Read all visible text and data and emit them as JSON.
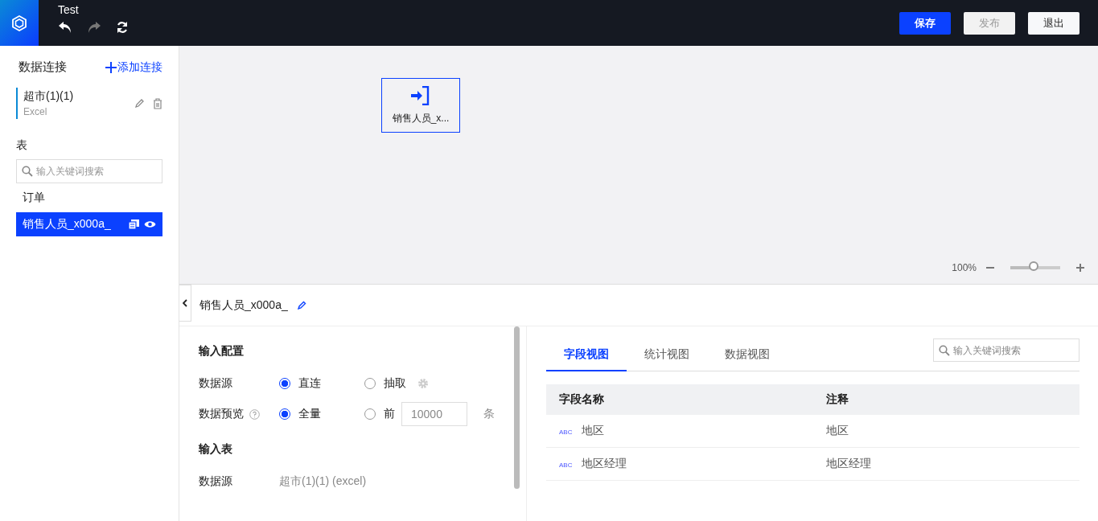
{
  "header": {
    "title": "Test",
    "buttons": [
      {
        "label": "保存",
        "kind": "primary",
        "disabled": false
      },
      {
        "label": "发布",
        "kind": "default",
        "disabled": true
      },
      {
        "label": "退出",
        "kind": "default",
        "disabled": false
      }
    ]
  },
  "sidebar": {
    "title": "数据连接",
    "add_link": "添加连接",
    "connections": [
      {
        "name": "超市(1)(1)",
        "type": "Excel",
        "selected": true
      }
    ],
    "tables_label": "表",
    "search": {
      "placeholder": "输入关键词搜索"
    },
    "tables": [
      {
        "name": "订单",
        "selected": false
      },
      {
        "name": "销售人员_x000a_",
        "selected": true
      }
    ]
  },
  "canvas": {
    "nodes": [
      {
        "label": "销售人员_x...",
        "selected": true
      }
    ],
    "zoom": {
      "reading": "100%",
      "level": 0.5
    }
  },
  "detail": {
    "title": "销售人员_x000a_",
    "config": {
      "title": "输入配置",
      "source": {
        "label": "数据源",
        "options": [
          {
            "label": "直连",
            "selected": true
          },
          {
            "label": "抽取",
            "selected": false
          }
        ]
      },
      "preview": {
        "label": "数据预览",
        "options": [
          {
            "label": "全量",
            "selected": true
          },
          {
            "label": "前",
            "selected": false
          }
        ],
        "limit": "10000",
        "unit": "条"
      }
    },
    "input_table": {
      "title": "输入表",
      "label": "数据源",
      "value": "超市(1)(1) (excel)"
    },
    "tabs": [
      {
        "label": "字段视图",
        "selected": true
      },
      {
        "label": "统计视图",
        "selected": false
      },
      {
        "label": "数据视图",
        "selected": false
      }
    ],
    "search": {
      "placeholder": "输入关键词搜索"
    },
    "table": {
      "columns": [
        "字段名称",
        "注释"
      ],
      "rows": [
        {
          "type": "ABC",
          "name": "地区",
          "comment": "地区"
        },
        {
          "type": "ABC",
          "name": "地区经理",
          "comment": "地区经理"
        }
      ]
    }
  }
}
